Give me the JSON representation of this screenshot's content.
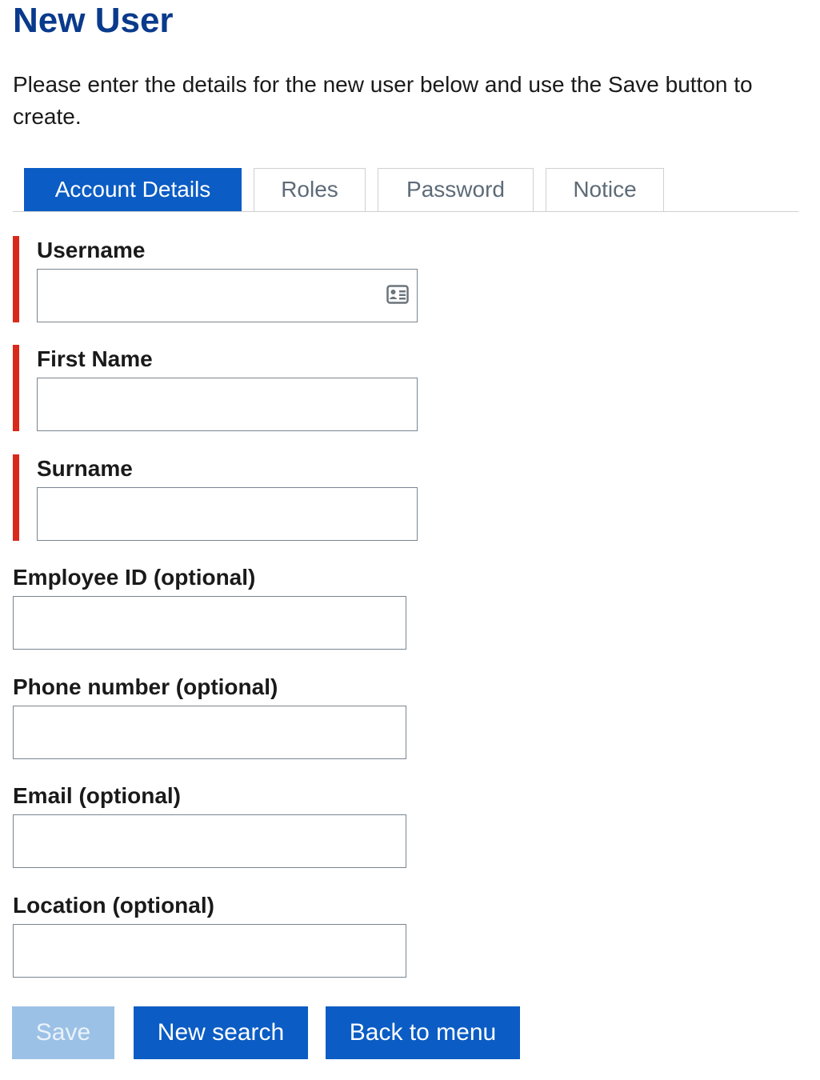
{
  "header": {
    "title": "New User",
    "intro": "Please enter the details for the new user below and use the Save button to create."
  },
  "tabs": [
    {
      "label": "Account Details",
      "active": true
    },
    {
      "label": "Roles",
      "active": false
    },
    {
      "label": "Password",
      "active": false
    },
    {
      "label": "Notice",
      "active": false
    }
  ],
  "form": {
    "username": {
      "label": "Username",
      "value": "",
      "required": true,
      "icon": "contact-card-icon"
    },
    "first_name": {
      "label": "First Name",
      "value": "",
      "required": true
    },
    "surname": {
      "label": "Surname",
      "value": "",
      "required": true
    },
    "employee_id": {
      "label": "Employee ID (optional)",
      "value": "",
      "required": false
    },
    "phone": {
      "label": "Phone number (optional)",
      "value": "",
      "required": false
    },
    "email": {
      "label": "Email (optional)",
      "value": "",
      "required": false
    },
    "location": {
      "label": "Location (optional)",
      "value": "",
      "required": false
    }
  },
  "actions": {
    "save_label": "Save",
    "save_disabled": true,
    "new_search_label": "New search",
    "back_label": "Back to menu"
  },
  "colors": {
    "brand": "#0a3a8c",
    "primary": "#0b5cc4",
    "primary_disabled": "#9cc1e6",
    "required_marker": "#d9291c",
    "tab_inactive_text": "#5d6b78"
  }
}
